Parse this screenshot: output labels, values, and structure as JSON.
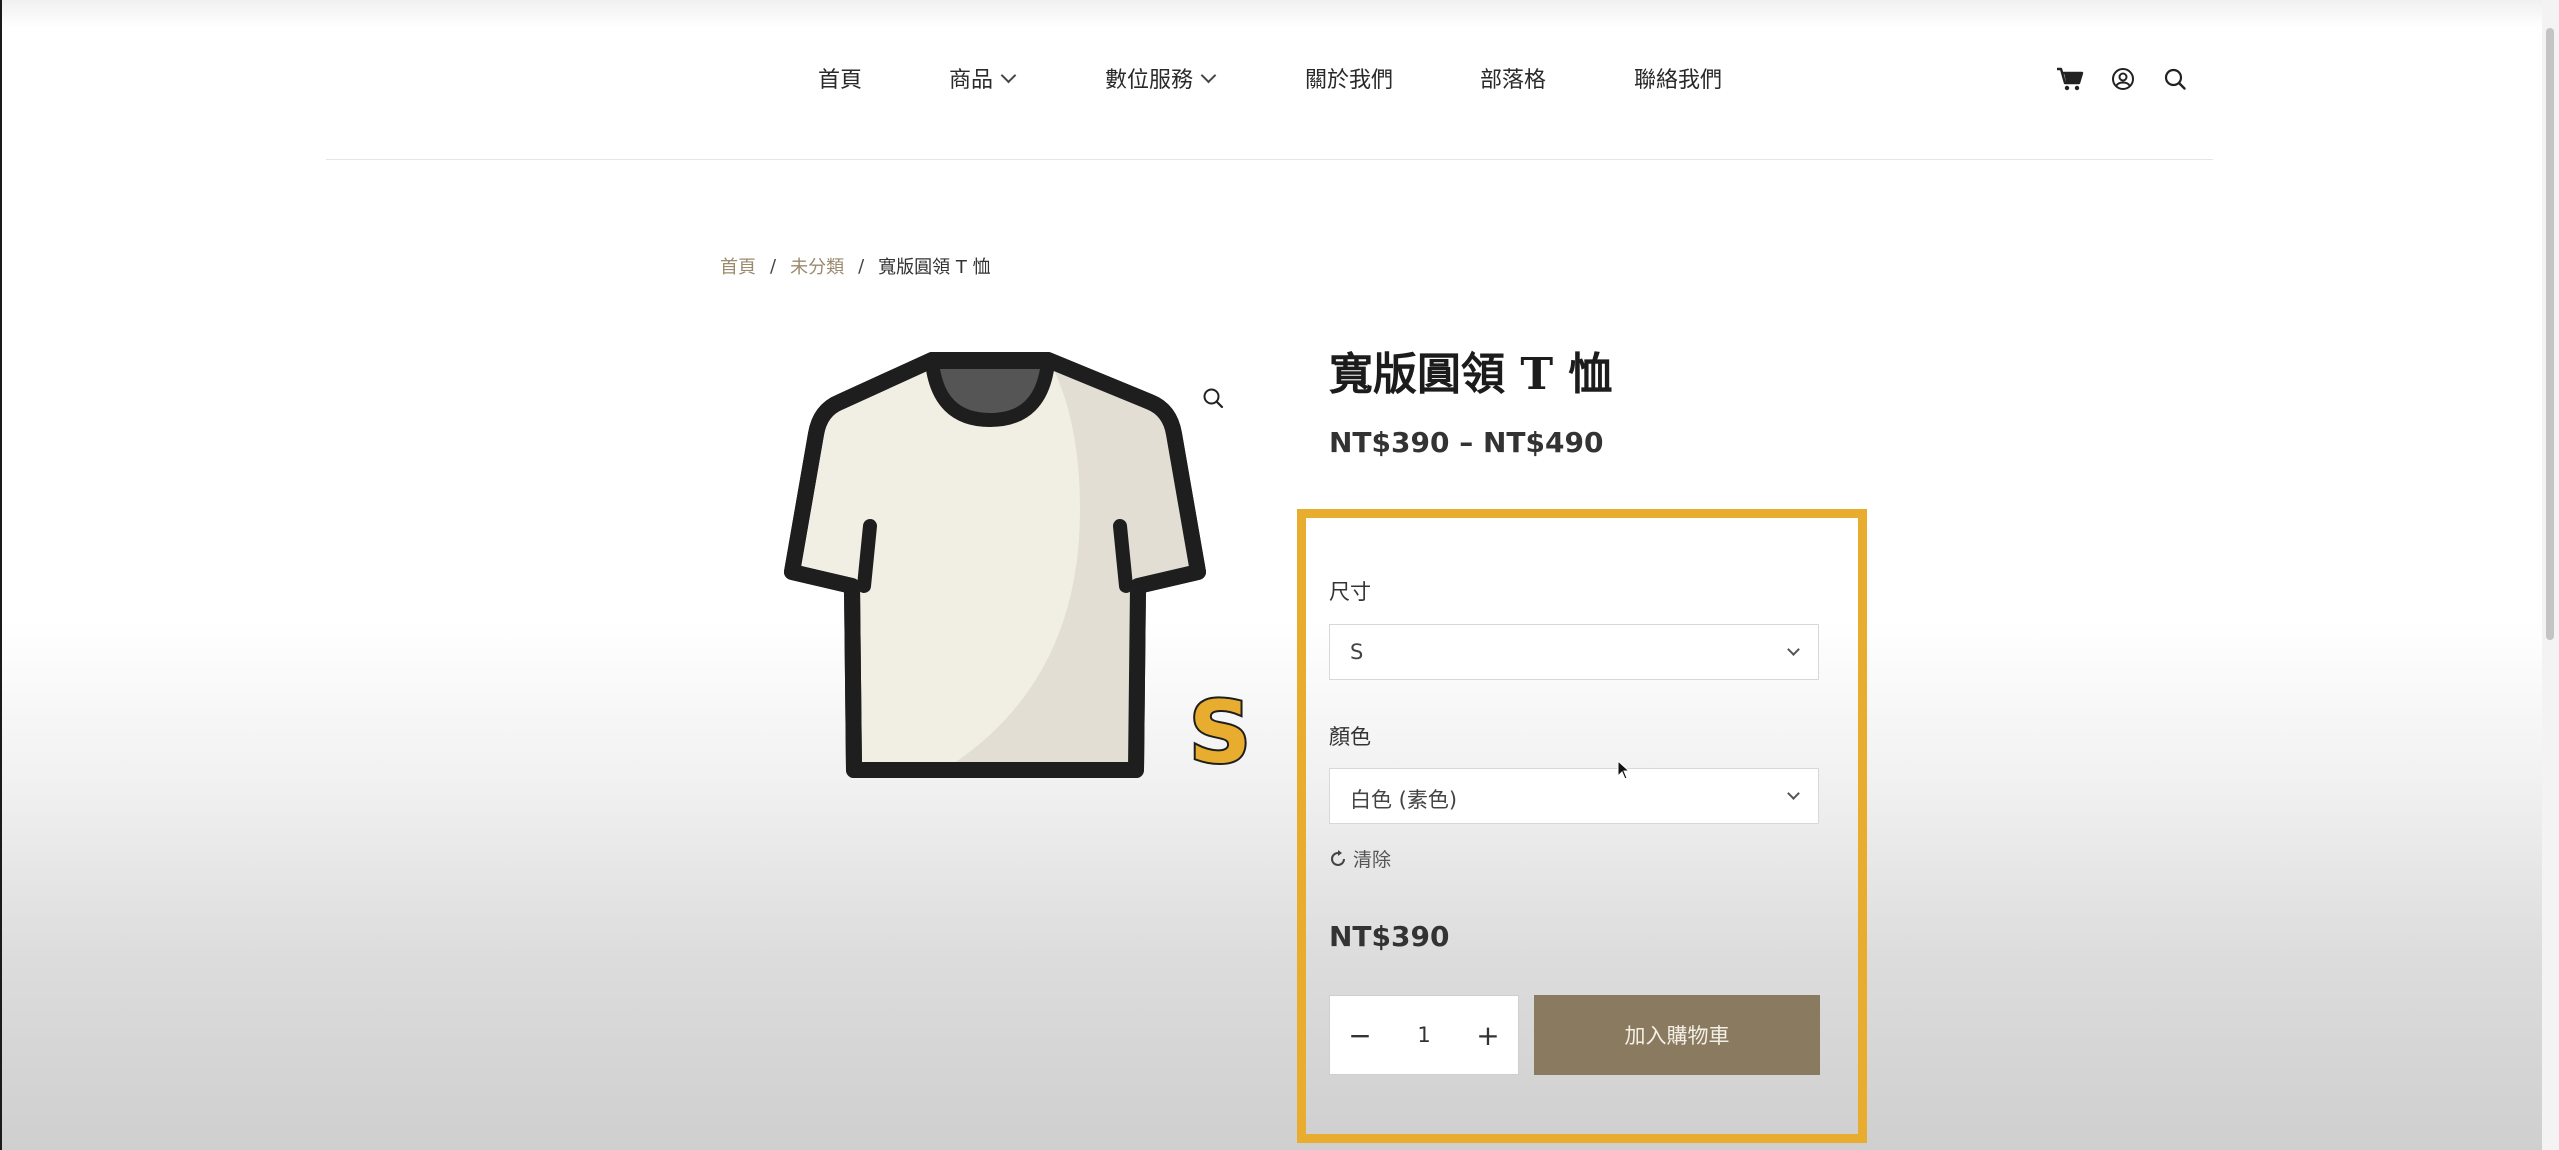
{
  "header": {
    "nav": [
      {
        "label": "首頁",
        "dropdown": false
      },
      {
        "label": "商品",
        "dropdown": true
      },
      {
        "label": "數位服務",
        "dropdown": true
      },
      {
        "label": "關於我們",
        "dropdown": false
      },
      {
        "label": "部落格",
        "dropdown": false
      },
      {
        "label": "聯絡我們",
        "dropdown": false
      }
    ],
    "icons": [
      "cart-icon",
      "user-icon",
      "search-icon"
    ]
  },
  "breadcrumb": {
    "home": "首頁",
    "category": "未分類",
    "current": "寬版圓領 T 恤",
    "separator": "/"
  },
  "product": {
    "title": "寬版圓領 T 恤",
    "price_range": "NT$390 – NT$490",
    "image_badge": "S",
    "zoom_icon": "magnify-icon"
  },
  "variations": {
    "size_label": "尺寸",
    "size_value": "S",
    "color_label": "顏色",
    "color_value": "白色 (素色)",
    "clear_label": "清除"
  },
  "selected_price": "NT$390",
  "quantity": {
    "minus": "−",
    "value": "1",
    "plus": "+"
  },
  "add_to_cart_label": "加入購物車",
  "colors": {
    "highlight": "#e8ad2e",
    "button": "#8a7a60",
    "link": "#9a8a6e"
  }
}
